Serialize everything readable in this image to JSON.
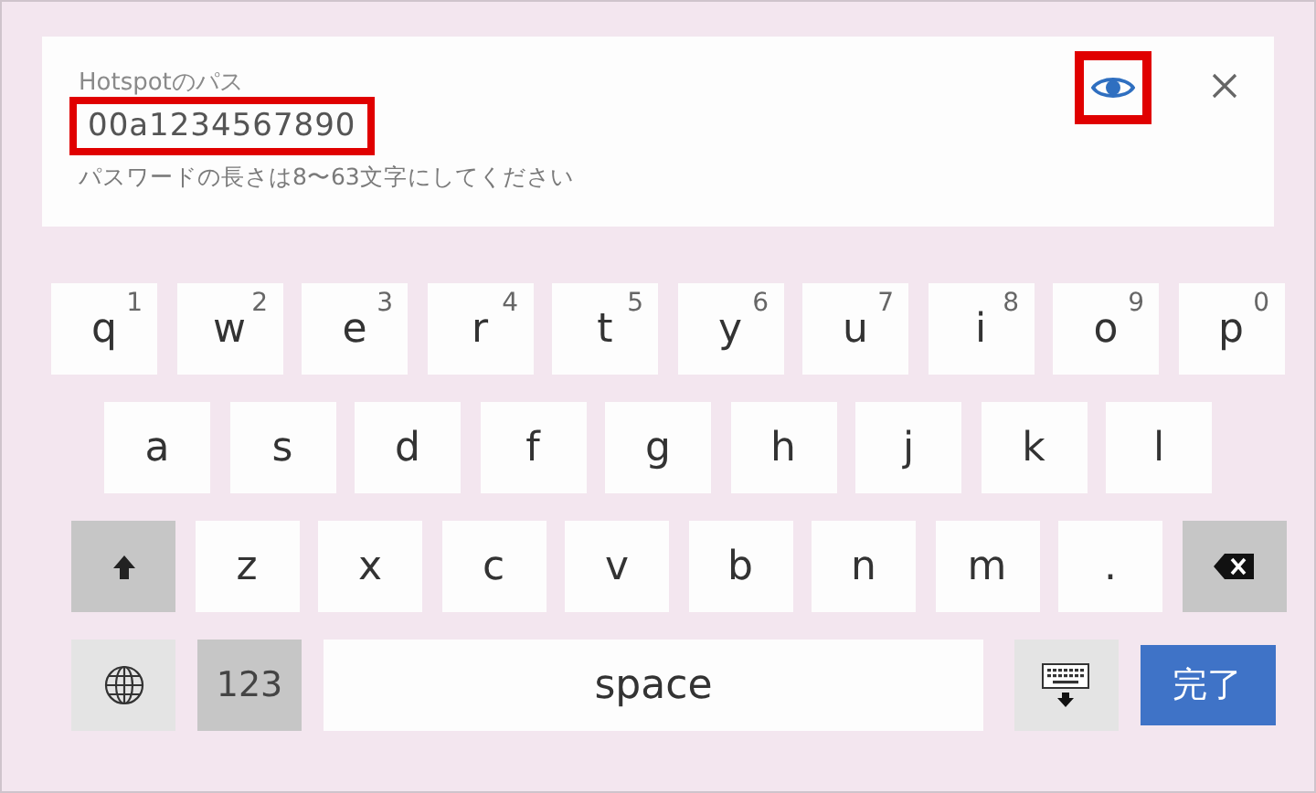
{
  "field": {
    "label": "Hotspotのパス",
    "value": "00a1234567890",
    "value_highlighted": true,
    "hint": "パスワードの長さは8〜63文字にしてください",
    "visibility_highlighted": true
  },
  "keyboard": {
    "rows": [
      {
        "keys": [
          {
            "kind": "letter",
            "label": "q",
            "alt": "1"
          },
          {
            "kind": "letter",
            "label": "w",
            "alt": "2"
          },
          {
            "kind": "letter",
            "label": "e",
            "alt": "3"
          },
          {
            "kind": "letter",
            "label": "r",
            "alt": "4"
          },
          {
            "kind": "letter",
            "label": "t",
            "alt": "5"
          },
          {
            "kind": "letter",
            "label": "y",
            "alt": "6"
          },
          {
            "kind": "letter",
            "label": "u",
            "alt": "7"
          },
          {
            "kind": "letter",
            "label": "i",
            "alt": "8"
          },
          {
            "kind": "letter",
            "label": "o",
            "alt": "9"
          },
          {
            "kind": "letter",
            "label": "p",
            "alt": "0"
          }
        ]
      },
      {
        "keys": [
          {
            "kind": "letter",
            "label": "a"
          },
          {
            "kind": "letter",
            "label": "s"
          },
          {
            "kind": "letter",
            "label": "d"
          },
          {
            "kind": "letter",
            "label": "f"
          },
          {
            "kind": "letter",
            "label": "g"
          },
          {
            "kind": "letter",
            "label": "h"
          },
          {
            "kind": "letter",
            "label": "j"
          },
          {
            "kind": "letter",
            "label": "k"
          },
          {
            "kind": "letter",
            "label": "l"
          }
        ]
      },
      {
        "keys": [
          {
            "kind": "shift"
          },
          {
            "kind": "letter",
            "label": "z"
          },
          {
            "kind": "letter",
            "label": "x"
          },
          {
            "kind": "letter",
            "label": "c"
          },
          {
            "kind": "letter",
            "label": "v"
          },
          {
            "kind": "letter",
            "label": "b"
          },
          {
            "kind": "letter",
            "label": "n"
          },
          {
            "kind": "letter",
            "label": "m"
          },
          {
            "kind": "letter",
            "label": "."
          },
          {
            "kind": "backspace"
          }
        ]
      },
      {
        "keys": [
          {
            "kind": "globe"
          },
          {
            "kind": "mode",
            "label": "123"
          },
          {
            "kind": "space",
            "label": "space"
          },
          {
            "kind": "hide"
          },
          {
            "kind": "done",
            "label": "完了"
          }
        ]
      }
    ]
  }
}
